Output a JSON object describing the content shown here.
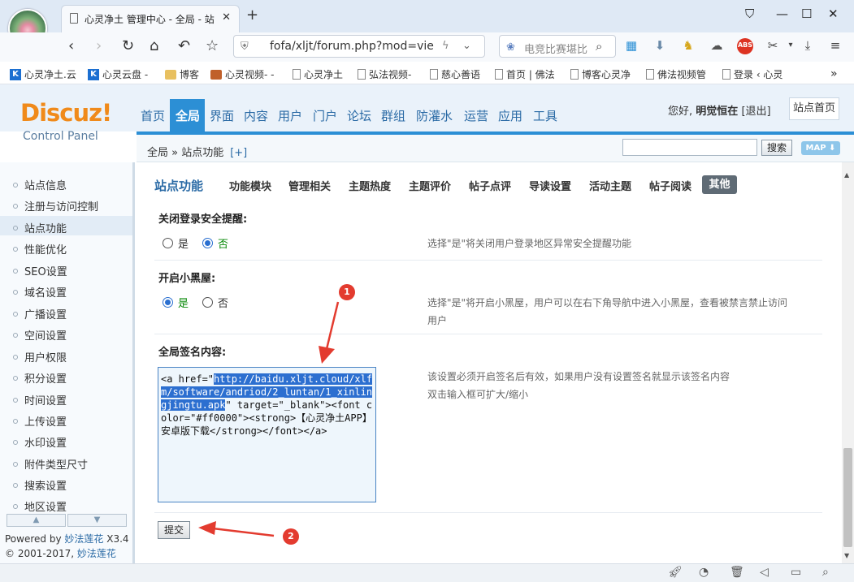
{
  "browser": {
    "tab_title": "心灵净土 管理中心 - 全局 - 站",
    "new_tab": "+",
    "url": "fofa/xljt/forum.php?mod=vie",
    "search_placeholder": "电竞比赛堪比",
    "bookmarks": [
      "心灵净土.云",
      "心灵云盘 -",
      "博客",
      "心灵视频- -",
      "心灵净土",
      "弘法视频-",
      "慈心善语",
      "首页 | 佛法",
      "博客心灵净",
      "佛法视频管",
      "登录 ‹ 心灵"
    ],
    "bookmarks_more": "»"
  },
  "header": {
    "logo_main": "Discuz!",
    "logo_sub": "Control Panel",
    "nav": [
      "首页",
      "全局",
      "界面",
      "内容",
      "用户",
      "门户",
      "论坛",
      "群组",
      "防灌水",
      "运营",
      "应用",
      "工具"
    ],
    "active_nav": "全局",
    "greeting_prefix": "您好,",
    "user": "明觉恒在",
    "logout": "[退出]",
    "site_home": "站点首页",
    "breadcrumb": "全局 » 站点功能",
    "breadcrumb_add": "[+]",
    "search_button": "搜索",
    "map_button": "MAP ⬇"
  },
  "sidebar": {
    "items": [
      "站点信息",
      "注册与访问控制",
      "站点功能",
      "性能优化",
      "SEO设置",
      "域名设置",
      "广播设置",
      "空间设置",
      "用户权限",
      "积分设置",
      "时间设置",
      "上传设置",
      "水印设置",
      "附件类型尺寸",
      "搜索设置",
      "地区设置"
    ],
    "active": "站点功能",
    "up": "▲",
    "down": "▼",
    "powered_prefix": "Powered by",
    "powered_link": "妙法莲花",
    "powered_version": "X3.4",
    "copyright_prefix": "© 2001-2017,",
    "copyright_link": "妙法莲花"
  },
  "content": {
    "title": "站点功能",
    "tabs": [
      "功能模块",
      "管理相关",
      "主题热度",
      "主题评价",
      "帖子点评",
      "导读设置",
      "活动主题",
      "帖子阅读",
      "其他"
    ],
    "active_tab": "其他",
    "field1": {
      "label": "关闭登录安全提醒:",
      "yes": "是",
      "no": "否",
      "selected": "否",
      "help": "选择\"是\"将关闭用户登录地区异常安全提醒功能"
    },
    "field2": {
      "label": "开启小黑屋:",
      "yes": "是",
      "no": "否",
      "selected": "是",
      "help_line1": "选择\"是\"将开启小黑屋，用户可以在右下角导航中进入小黑屋，查看被禁言禁止访问",
      "help_line2": "用户"
    },
    "field3": {
      "label": "全局签名内容:",
      "value_before": "<a href=\"",
      "value_selected": "http://baidu.xljt.cloud/xlfm/software/andriod/2_luntan/1_xinlingjingtu.apk",
      "value_after": "\" target=\"_blank\"><font color=\"#ff0000\"><strong>【心灵净土APP】安卓版下载</strong></font></a>",
      "help_line1": "该设置必须开启签名后有效，如果用户没有设置签名就显示该签名内容",
      "help_line2": "双击输入框可扩大/缩小"
    },
    "submit": "提交",
    "annotation1": "1",
    "annotation2": "2"
  },
  "colors": {
    "accent": "#2c8fd5",
    "annotation": "#e33b2f",
    "logo": "#f08a1a",
    "selection": "#2c6fd0"
  }
}
